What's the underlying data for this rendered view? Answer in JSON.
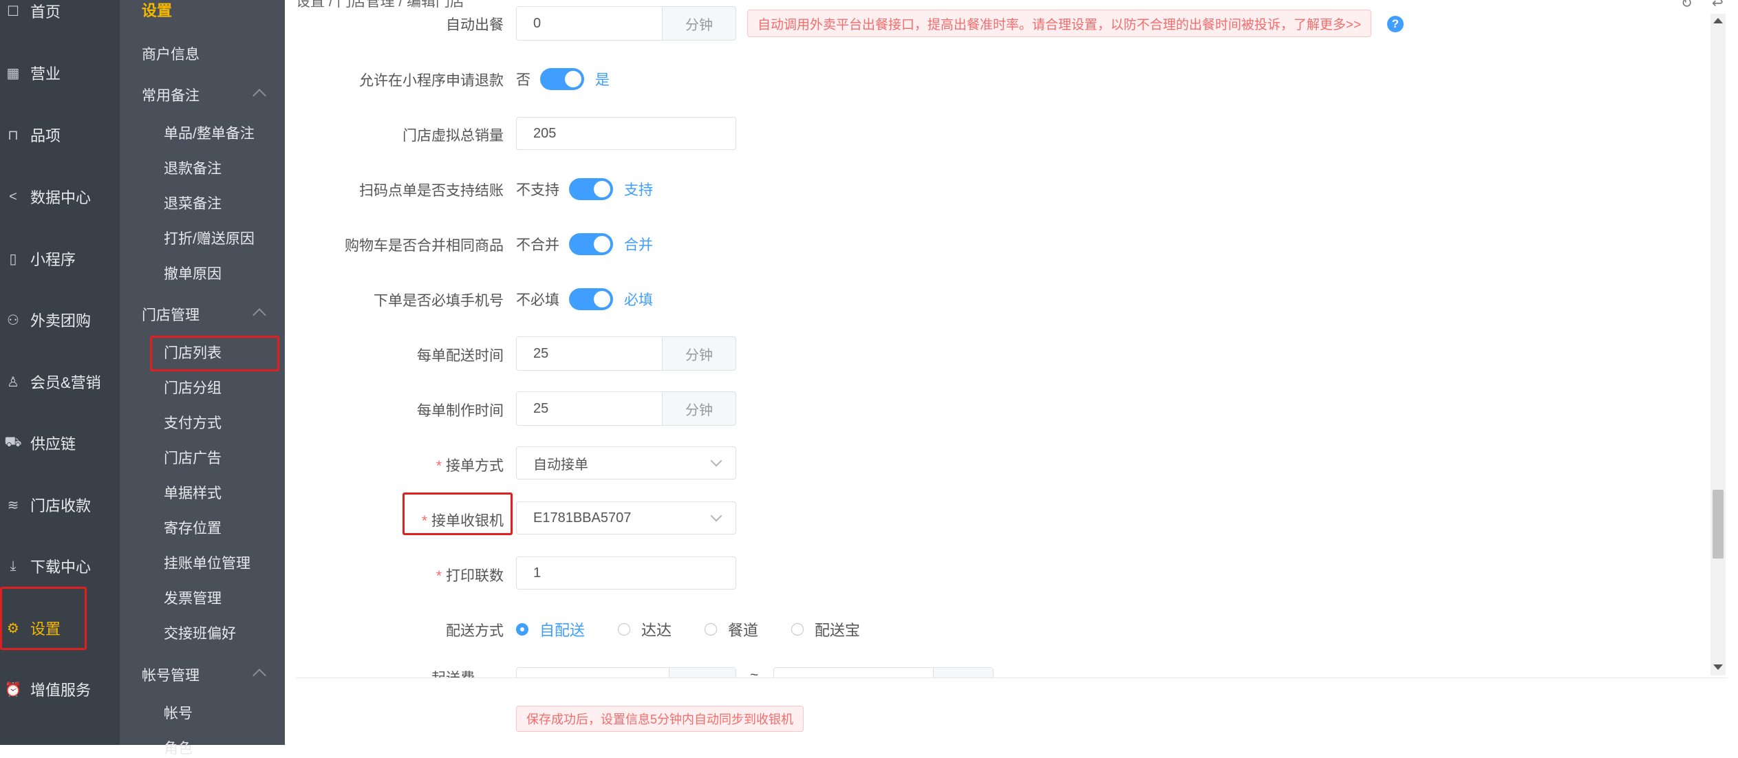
{
  "nav_primary": {
    "items": [
      {
        "label": "首页",
        "icon": "home-icon",
        "glyph": "☐"
      },
      {
        "label": "营业",
        "icon": "calendar-icon",
        "glyph": "▦"
      },
      {
        "label": "品项",
        "icon": "bag-icon",
        "glyph": "⊓"
      },
      {
        "label": "数据中心",
        "icon": "share-icon",
        "glyph": "<"
      },
      {
        "label": "小程序",
        "icon": "phone-icon",
        "glyph": "▯"
      },
      {
        "label": "外卖团购",
        "icon": "bike-icon",
        "glyph": "⚇"
      },
      {
        "label": "会员&营销",
        "icon": "user-icon",
        "glyph": "♙"
      },
      {
        "label": "供应链",
        "icon": "truck-icon",
        "glyph": "⛟"
      },
      {
        "label": "门店收款",
        "icon": "database-icon",
        "glyph": "≋"
      },
      {
        "label": "下载中心",
        "icon": "download-icon",
        "glyph": "⤓"
      },
      {
        "label": "设置",
        "icon": "gear-icon",
        "glyph": "⚙"
      },
      {
        "label": "增值服务",
        "icon": "alarm-icon",
        "glyph": "⏰"
      }
    ],
    "active_color": "#f5b700"
  },
  "nav_secondary": {
    "title": "设置",
    "merchant_info": "商户信息",
    "group_notes": {
      "label": "常用备注",
      "items": [
        "单品/整单备注",
        "退款备注",
        "退菜备注",
        "打折/赠送原因",
        "撤单原因"
      ]
    },
    "group_store": {
      "label": "门店管理",
      "items": [
        "门店列表",
        "门店分组",
        "支付方式",
        "门店广告",
        "单据样式",
        "寄存位置",
        "挂账单位管理",
        "发票管理",
        "交接班偏好"
      ]
    },
    "group_account": {
      "label": "帐号管理",
      "items": [
        "帐号",
        "角色"
      ]
    }
  },
  "breadcrumb": "设置 / 门店管理 / 编辑门店",
  "form": {
    "auto_out": {
      "label": "自动出餐",
      "value": "0",
      "suffix": "分钟",
      "tip": "自动调用外卖平台出餐接口，提高出餐准时率。请合理设置，以防不合理的出餐时间被投诉，了解更多>>",
      "help": "?"
    },
    "refund_mini": {
      "label": "允许在小程序申请退款",
      "off": "否",
      "on": "是"
    },
    "virtual_sales": {
      "label": "门店虚拟总销量",
      "value": "205"
    },
    "scan_checkout": {
      "label": "扫码点单是否支持结账",
      "off": "不支持",
      "on": "支持"
    },
    "cart_merge": {
      "label": "购物车是否合并相同商品",
      "off": "不合并",
      "on": "合并"
    },
    "phone_required": {
      "label": "下单是否必填手机号",
      "off": "不必填",
      "on": "必填"
    },
    "delivery_time": {
      "label": "每单配送时间",
      "value": "25",
      "suffix": "分钟"
    },
    "make_time": {
      "label": "每单制作时间",
      "value": "25",
      "suffix": "分钟"
    },
    "accept_mode": {
      "label": "接单方式",
      "required": "*",
      "value": "自动接单"
    },
    "accept_cashier": {
      "label": "接单收银机",
      "required": "*",
      "value": "E1781BBA5707"
    },
    "print_copies": {
      "label": "打印联数",
      "required": "*",
      "value": "1"
    },
    "delivery_mode": {
      "label": "配送方式",
      "options": [
        "自配送",
        "达达",
        "餐道",
        "配送宝"
      ],
      "selected": "自配送"
    },
    "delivery_fee": {
      "label": "起送费",
      "between": "~"
    }
  },
  "save_tip": "保存成功后，设置信息5分钟内自动同步到收银机",
  "colors": {
    "primary": "#409eff",
    "highlight": "#e02020",
    "danger": "#f56c6c"
  }
}
